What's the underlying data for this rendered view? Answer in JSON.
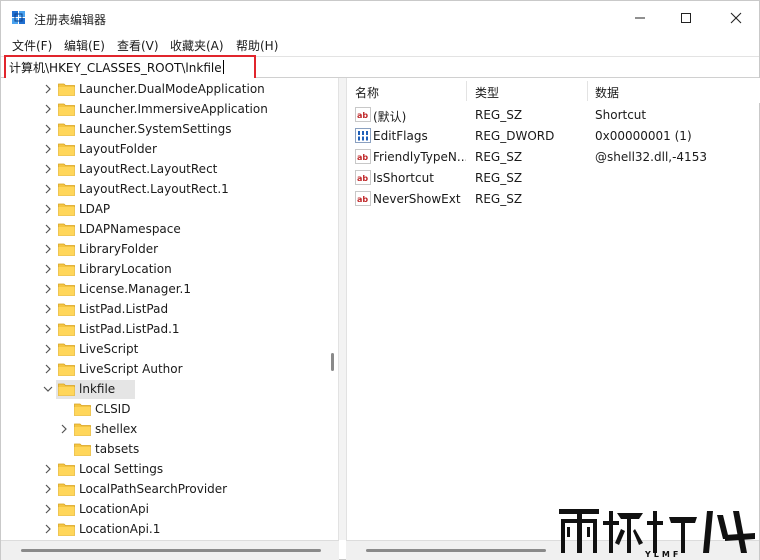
{
  "window": {
    "title": "注册表编辑器",
    "controls": [
      "minimize",
      "maximize",
      "close"
    ]
  },
  "menu": [
    "文件(F)",
    "编辑(E)",
    "查看(V)",
    "收藏夹(A)",
    "帮助(H)"
  ],
  "address": {
    "value": "计算机\\HKEY_CLASSES_ROOT\\lnkfile"
  },
  "tree": {
    "items": [
      {
        "label": "Launcher.DualModeApplication",
        "level": 1,
        "expandable": true,
        "expanded": false
      },
      {
        "label": "Launcher.ImmersiveApplication",
        "level": 1,
        "expandable": true,
        "expanded": false
      },
      {
        "label": "Launcher.SystemSettings",
        "level": 1,
        "expandable": true,
        "expanded": false
      },
      {
        "label": "LayoutFolder",
        "level": 1,
        "expandable": true,
        "expanded": false
      },
      {
        "label": "LayoutRect.LayoutRect",
        "level": 1,
        "expandable": true,
        "expanded": false
      },
      {
        "label": "LayoutRect.LayoutRect.1",
        "level": 1,
        "expandable": true,
        "expanded": false
      },
      {
        "label": "LDAP",
        "level": 1,
        "expandable": true,
        "expanded": false
      },
      {
        "label": "LDAPNamespace",
        "level": 1,
        "expandable": true,
        "expanded": false
      },
      {
        "label": "LibraryFolder",
        "level": 1,
        "expandable": true,
        "expanded": false
      },
      {
        "label": "LibraryLocation",
        "level": 1,
        "expandable": true,
        "expanded": false
      },
      {
        "label": "License.Manager.1",
        "level": 1,
        "expandable": true,
        "expanded": false
      },
      {
        "label": "ListPad.ListPad",
        "level": 1,
        "expandable": true,
        "expanded": false
      },
      {
        "label": "ListPad.ListPad.1",
        "level": 1,
        "expandable": true,
        "expanded": false
      },
      {
        "label": "LiveScript",
        "level": 1,
        "expandable": true,
        "expanded": false
      },
      {
        "label": "LiveScript Author",
        "level": 1,
        "expandable": true,
        "expanded": false
      },
      {
        "label": "lnkfile",
        "level": 1,
        "expandable": true,
        "expanded": true,
        "selected": true
      },
      {
        "label": "CLSID",
        "level": 2,
        "expandable": false,
        "expanded": false
      },
      {
        "label": "shellex",
        "level": 2,
        "expandable": true,
        "expanded": false
      },
      {
        "label": "tabsets",
        "level": 2,
        "expandable": false,
        "expanded": false
      },
      {
        "label": "Local Settings",
        "level": 1,
        "expandable": true,
        "expanded": false
      },
      {
        "label": "LocalPathSearchProvider",
        "level": 1,
        "expandable": true,
        "expanded": false
      },
      {
        "label": "LocationApi",
        "level": 1,
        "expandable": true,
        "expanded": false
      },
      {
        "label": "LocationApi.1",
        "level": 1,
        "expandable": true,
        "expanded": false
      }
    ]
  },
  "list": {
    "columns": [
      "名称",
      "类型",
      "数据"
    ],
    "rows": [
      {
        "icon": "string-value-icon",
        "name": "(默认)",
        "type": "REG_SZ",
        "data": "Shortcut"
      },
      {
        "icon": "binary-value-icon",
        "name": "EditFlags",
        "type": "REG_DWORD",
        "data": "0x00000001 (1)"
      },
      {
        "icon": "string-value-icon",
        "name": "FriendlyTypeN...",
        "type": "REG_SZ",
        "data": "@shell32.dll,-4153"
      },
      {
        "icon": "string-value-icon",
        "name": "IsShortcut",
        "type": "REG_SZ",
        "data": ""
      },
      {
        "icon": "string-value-icon",
        "name": "NeverShowExt",
        "type": "REG_SZ",
        "data": ""
      }
    ]
  },
  "colors": {
    "address_highlight": "#e1252c",
    "folder": "#f4c542",
    "selection": "#e5e5e5"
  }
}
